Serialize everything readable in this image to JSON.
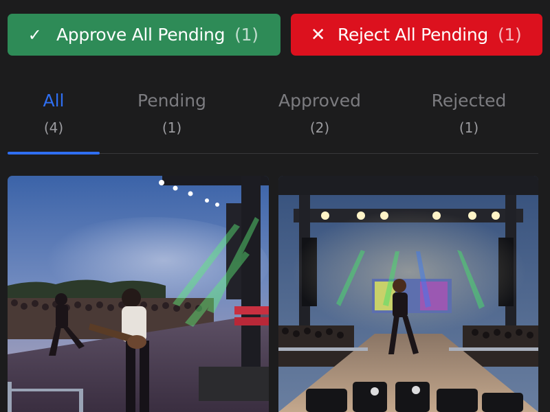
{
  "actions": {
    "approve": {
      "icon": "check-icon",
      "icon_glyph": "✓",
      "label": "Approve All Pending",
      "count": "(1)",
      "color": "#2e8b57"
    },
    "reject": {
      "icon": "x-icon",
      "icon_glyph": "✕",
      "label": "Reject All Pending",
      "count": "(1)",
      "color": "#dc111e"
    }
  },
  "tabs": [
    {
      "label": "All",
      "count": "(4)",
      "active": true
    },
    {
      "label": "Pending",
      "count": "(1)",
      "active": false
    },
    {
      "label": "Approved",
      "count": "(2)",
      "active": false
    },
    {
      "label": "Rejected",
      "count": "(1)",
      "active": false
    }
  ],
  "theme": {
    "background": "#1c1c1d",
    "accent": "#2f6ff2"
  }
}
